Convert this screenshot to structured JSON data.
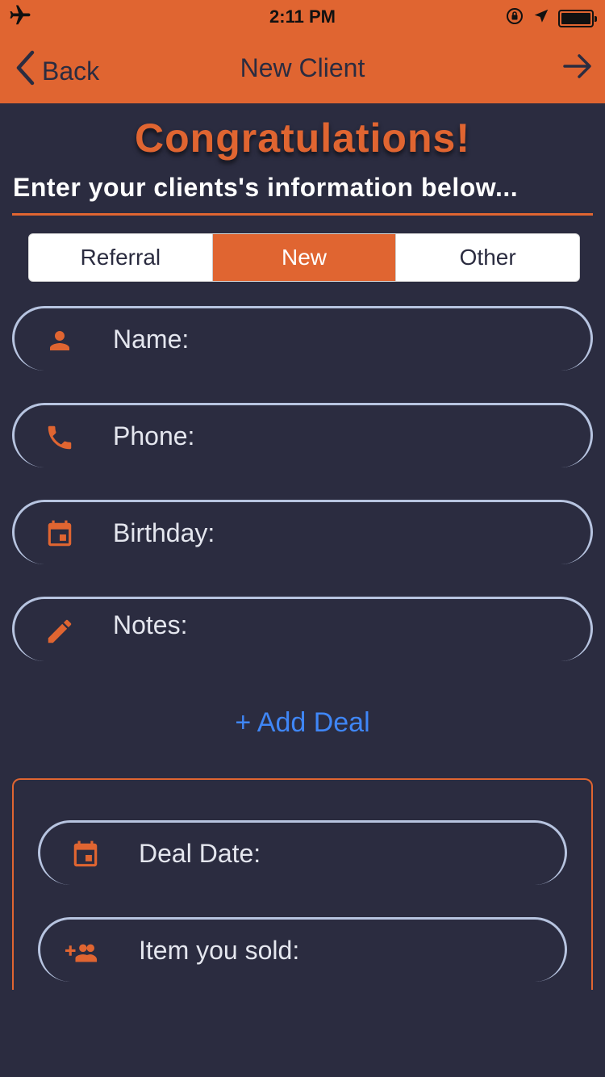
{
  "status_bar": {
    "time": "2:11 PM",
    "icons": [
      "airplane-icon",
      "orientation-lock-icon",
      "location-arrow-icon",
      "battery-icon"
    ]
  },
  "nav": {
    "back_label": "Back",
    "title": "New Client",
    "next_icon": "arrow-right-icon"
  },
  "header": {
    "congrats": "Congratulations!",
    "subtitle": "Enter your clients's information below..."
  },
  "segment": {
    "options": [
      "Referral",
      "New",
      "Other"
    ],
    "selected": "New"
  },
  "fields": {
    "name_placeholder": "Name:",
    "phone_placeholder": "Phone:",
    "birthday_placeholder": "Birthday:",
    "notes_placeholder": "Notes:"
  },
  "deal": {
    "add_label": "+ Add Deal",
    "date_placeholder": "Deal Date:",
    "item_placeholder": "Item you sold:"
  },
  "colors": {
    "accent": "#e06531",
    "background": "#2b2c40",
    "field_border": "#b7c4e0",
    "link": "#3f86f6"
  }
}
